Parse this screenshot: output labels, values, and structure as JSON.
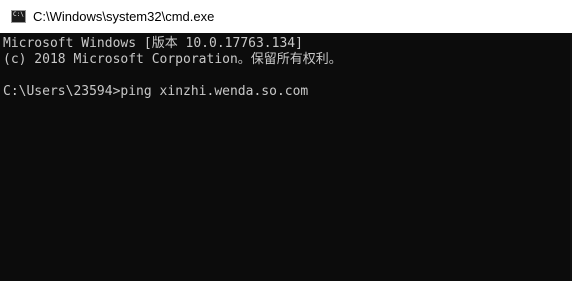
{
  "window": {
    "title": "C:\\Windows\\system32\\cmd.exe",
    "icon_name": "cmd-icon",
    "icon_glyph": "C:\\"
  },
  "console": {
    "line1": "Microsoft Windows [版本 10.0.17763.134]",
    "line2": "(c) 2018 Microsoft Corporation。保留所有权利。",
    "prompt": "C:\\Users\\23594>",
    "command": "ping xinzhi.wenda.so.com"
  },
  "colors": {
    "console_bg": "#0c0c0c",
    "console_text": "#c8c8c8",
    "titlebar_bg": "#ffffff"
  }
}
